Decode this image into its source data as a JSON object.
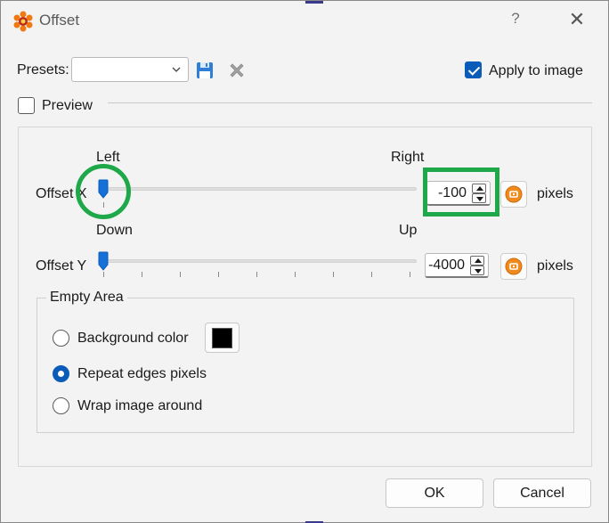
{
  "window": {
    "title": "Offset",
    "help_label": "?",
    "close_label": "✕"
  },
  "presets": {
    "label": "Presets:",
    "value": "",
    "save_icon": "save-icon",
    "delete_icon": "delete-icon"
  },
  "apply_to_image": {
    "label": "Apply to image",
    "checked": true
  },
  "preview": {
    "label": "Preview",
    "checked": false
  },
  "offset_x": {
    "label": "Offset X",
    "left_label": "Left",
    "right_label": "Right",
    "value": "-100",
    "unit": "pixels"
  },
  "offset_y": {
    "label": "Offset Y",
    "down_label": "Down",
    "up_label": "Up",
    "value": "-4000",
    "unit": "pixels"
  },
  "empty_area": {
    "title": "Empty Area",
    "options": [
      {
        "label": "Background color",
        "selected": false
      },
      {
        "label": "Repeat edges pixels",
        "selected": true
      },
      {
        "label": "Wrap image around",
        "selected": false
      }
    ],
    "background_color": "#000000"
  },
  "buttons": {
    "ok": "OK",
    "cancel": "Cancel"
  },
  "colors": {
    "accent": "#0b5cb8",
    "highlight": "#1ea84a",
    "reset_icon": "#f08a1c"
  }
}
